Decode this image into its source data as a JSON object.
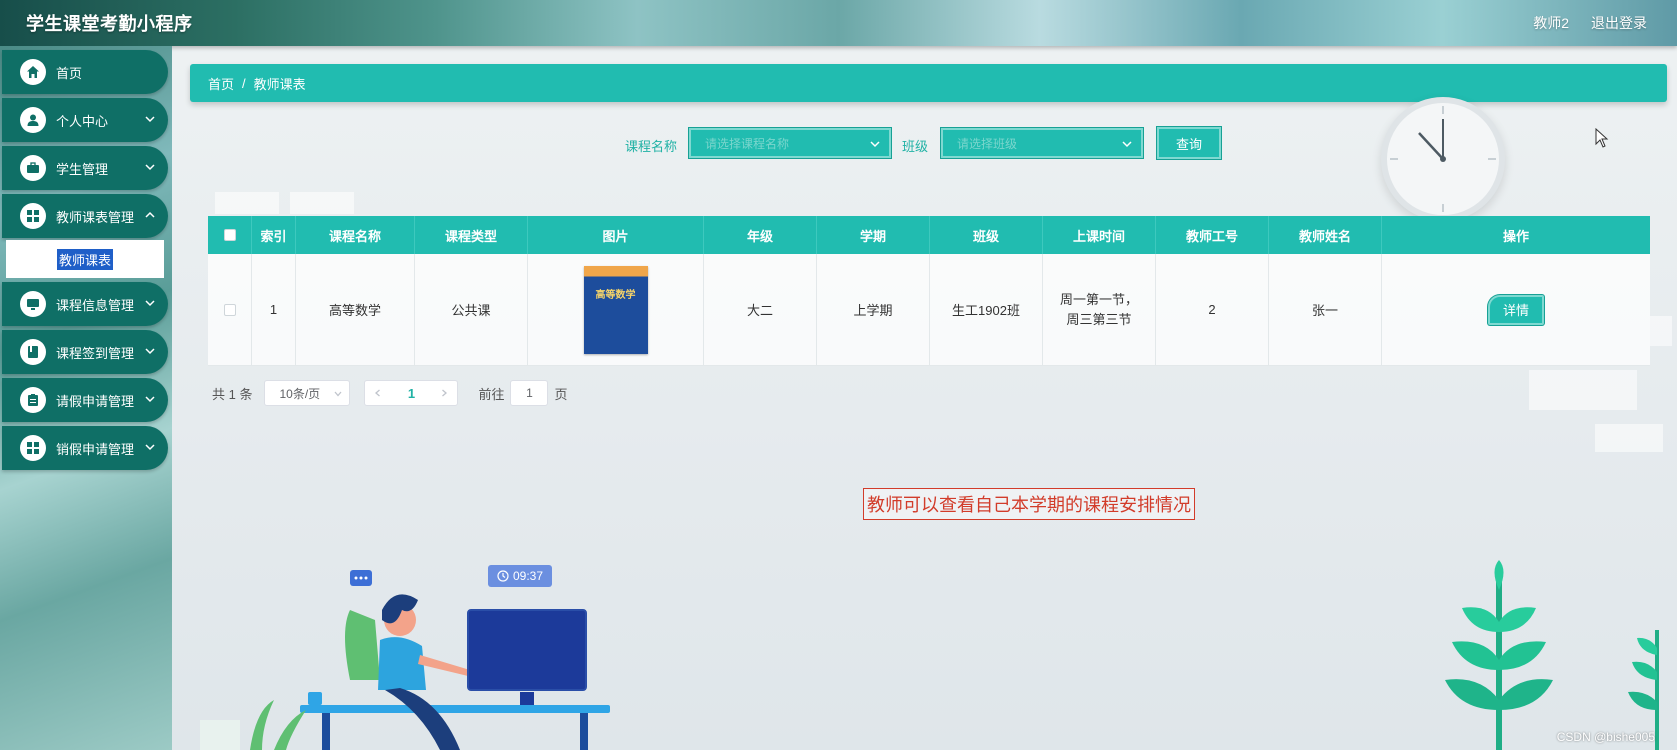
{
  "app": {
    "title": "学生课堂考勤小程序"
  },
  "header": {
    "user": "教师2",
    "logout": "退出登录"
  },
  "sidebar": {
    "items": [
      {
        "label": "首页",
        "icon": "home-icon"
      },
      {
        "label": "个人中心",
        "icon": "user-icon"
      },
      {
        "label": "学生管理",
        "icon": "briefcase-icon"
      },
      {
        "label": "教师课表管理",
        "icon": "grid-icon"
      },
      {
        "label": "课程信息管理",
        "icon": "monitor-icon"
      },
      {
        "label": "课程签到管理",
        "icon": "book-icon"
      },
      {
        "label": "请假申请管理",
        "icon": "clipboard-icon"
      },
      {
        "label": "销假申请管理",
        "icon": "grid-icon"
      }
    ],
    "active_submenu": "教师课表"
  },
  "breadcrumb": {
    "home": "首页",
    "separator": "/",
    "current": "教师课表"
  },
  "search": {
    "course_label": "课程名称",
    "course_placeholder": "请选择课程名称",
    "class_label": "班级",
    "class_placeholder": "请选择班级",
    "query_button": "查询"
  },
  "table": {
    "headers": [
      "索引",
      "课程名称",
      "课程类型",
      "图片",
      "年级",
      "学期",
      "班级",
      "上课时间",
      "教师工号",
      "教师姓名",
      "操作"
    ],
    "rows": [
      {
        "index": "1",
        "course_name": "高等数学",
        "course_type": "公共课",
        "image_title": "高等数学",
        "grade": "大二",
        "semester": "上学期",
        "class": "生工1902班",
        "time": "周一第一节，周三第三节",
        "teacher_id": "2",
        "teacher_name": "张一",
        "action": "详情"
      }
    ]
  },
  "pagination": {
    "total": "共 1 条",
    "page_size": "10条/页",
    "current_page": "1",
    "goto_label": "前往",
    "goto_value": "1",
    "page_suffix": "页"
  },
  "annotation": "教师可以查看自己本学期的课程安排情况",
  "illustration": {
    "time": "09:37"
  },
  "watermark": "CSDN @bishe005",
  "colors": {
    "primary": "#21bcb0",
    "sidebar_item": "#0f6f66",
    "annotation": "#d23c2a"
  }
}
